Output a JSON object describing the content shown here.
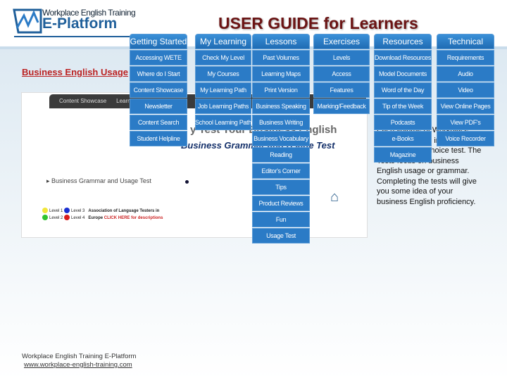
{
  "header": {
    "logo_small": "Workplace English Training",
    "logo_main": "E-Platform",
    "title": "USER GUIDE for Learners"
  },
  "page_link": "Business English Usage",
  "screenshot": {
    "tabs": [
      "Content Showcase",
      "Learn"
    ],
    "heading1": "y Test Your Business English",
    "heading2": "Business Grammar and Usage Test",
    "item": "Business Grammar and Usage Test",
    "legend": {
      "l1": "Level 1",
      "l2": "Level 2",
      "l3": "Level 3",
      "l4": "Level 4",
      "assoc1": "Association of Language Testers in",
      "assoc2": "Europe",
      "click": "CLICK HERE for descriptions"
    },
    "colors": {
      "level1": "#f2e63a",
      "level2": "#2fc42f",
      "level3": "#1a2fd0",
      "level4": "#d81c1c"
    }
  },
  "description": "Each volume of Workplace English Training includes a timed multiple choice test. The Tests focus on business English usage or grammar. Completing the tests will give you some idea of your business English proficiency.",
  "menu": [
    {
      "label": "Getting Started",
      "items": [
        "Accessing WETE",
        "Where do I Start",
        "Content Showcase",
        "Newsletter",
        "Content Search",
        "Student Helpline"
      ]
    },
    {
      "label": "My Learning",
      "items": [
        "Check My Level",
        "My Courses",
        "My Learning Path",
        "Job Learning Paths",
        "School Learning Path"
      ]
    },
    {
      "label": "Lessons",
      "items": [
        "Past Volumes",
        "Learning Maps",
        "Print Version",
        "Business Speaking",
        "Business Writing",
        "Business Vocabulary",
        "Reading",
        "Editor's Corner",
        "Tips",
        "Product Reviews",
        "Fun",
        "Usage Test"
      ]
    },
    {
      "label": "Exercises",
      "items": [
        "Levels",
        "Access",
        "Features",
        "Marking/Feedback"
      ]
    },
    {
      "label": "Resources",
      "items": [
        "Download Resources",
        "Model Documents",
        "Word of the Day",
        "Tip of the Week",
        "Podcasts",
        "e-Books",
        "Magazine"
      ]
    },
    {
      "label": "Technical",
      "items": [
        "Requirements",
        "Audio",
        "Video",
        "View Online Pages",
        "View PDF's",
        "Voice Recorder"
      ]
    }
  ],
  "footer": {
    "name": "Workplace English Training E-Platform",
    "url": "www.workplace-english-training.com"
  },
  "accent": "#2b7bc6"
}
